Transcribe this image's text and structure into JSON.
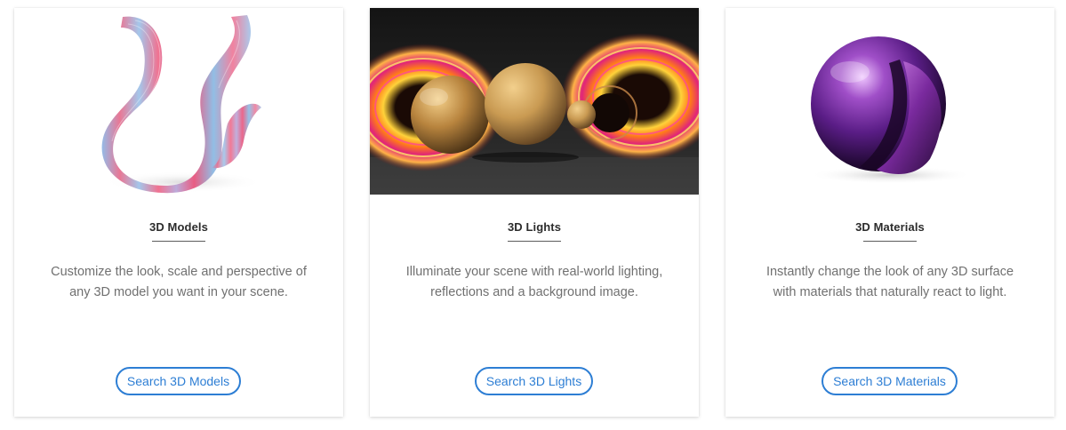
{
  "cards": [
    {
      "title": "3D Models",
      "description": "Customize the look, scale and perspective of any 3D model you want in your scene.",
      "button_label": "Search 3D Models",
      "image_icon": "twisted-ribbon-3d-model"
    },
    {
      "title": "3D Lights",
      "description": "Illuminate your scene with real-world lighting, reflections and a background image.",
      "button_label": "Search 3D Lights",
      "image_icon": "glowing-spheres-rings-render"
    },
    {
      "title": "3D Materials",
      "description": "Instantly change the look of any 3D surface with materials that naturally react to light.",
      "button_label": "Search 3D Materials",
      "image_icon": "metallic-purple-sphere"
    }
  ],
  "colors": {
    "accent": "#2d7ed4",
    "title": "#2c2c2c",
    "description": "#707070",
    "card_bg": "#ffffff"
  }
}
